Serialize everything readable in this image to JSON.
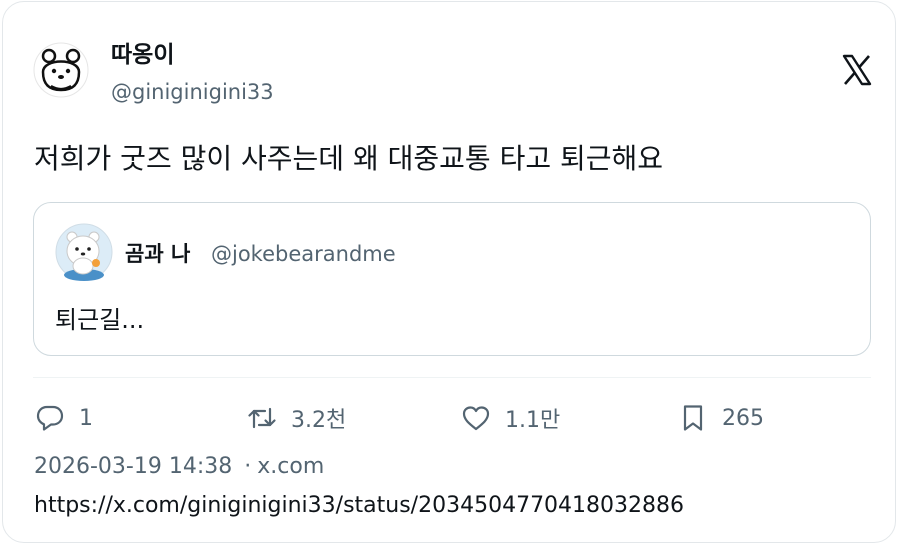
{
  "author": {
    "name": "따옹이",
    "handle": "@giniginigini33",
    "avatar_icon": "bear-face-outline-icon"
  },
  "platform_icon": "x-logo-icon",
  "tweet": {
    "text": "저희가 굿즈 많이 사주는데 왜 대중교통 타고 퇴근해요"
  },
  "quoted_tweet": {
    "name": "곰과 나",
    "handle": "@jokebearandme",
    "text": "퇴근길...",
    "avatar_icon": "white-bear-character-icon"
  },
  "actions": {
    "reply_count": "1",
    "retweet_count": "3.2천",
    "like_count": "1.1만",
    "bookmark_count": "265"
  },
  "meta": {
    "timestamp": "2026-03-19 14:38",
    "separator": "·",
    "source": "x.com"
  },
  "url": "https://x.com/giniginigini33/status/2034504770418032886",
  "colors": {
    "text_primary": "#0f1419",
    "text_secondary": "#536471",
    "border": "#cfd9de"
  }
}
